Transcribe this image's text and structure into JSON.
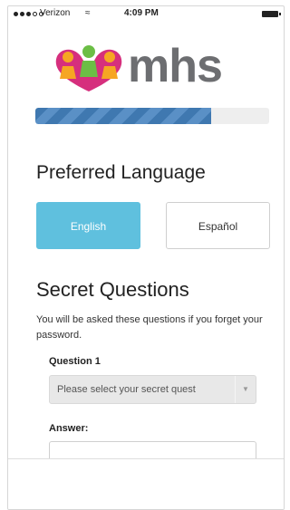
{
  "status_bar": {
    "carrier": "Verizon",
    "time": "4:09 PM"
  },
  "logo": {
    "text": "mhs"
  },
  "progress": {
    "fraction": 0.75
  },
  "preferred_language": {
    "title": "Preferred Language",
    "options": [
      "English",
      "Español"
    ],
    "selected": "English"
  },
  "secret_questions": {
    "title": "Secret Questions",
    "hint": "You will be asked these questions if you forget your password.",
    "question_label": "Question 1",
    "select_placeholder": "Please select your secret quest",
    "answer_label": "Answer:",
    "answer_value": ""
  },
  "colors": {
    "selected_button": "#5fc0de",
    "progress_blue": "#3f78b0",
    "logo_gray": "#6d6e71"
  }
}
